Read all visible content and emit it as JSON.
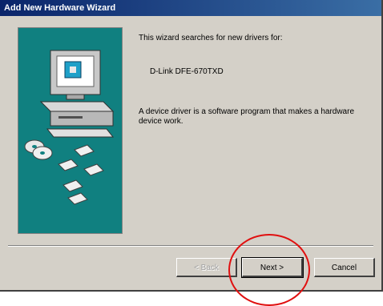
{
  "window": {
    "title": "Add New Hardware Wizard"
  },
  "content": {
    "intro": "This wizard searches for new drivers for:",
    "device": "D-Link DFE-670TXD",
    "description": "A device driver is a software program that makes a hardware device work."
  },
  "buttons": {
    "back_label": "< Back",
    "next_label": "Next >",
    "cancel_label": "Cancel"
  },
  "colors": {
    "title_bar": "#0a246a",
    "illustration_background": "#108080",
    "annotation_circle": "#e01010"
  }
}
